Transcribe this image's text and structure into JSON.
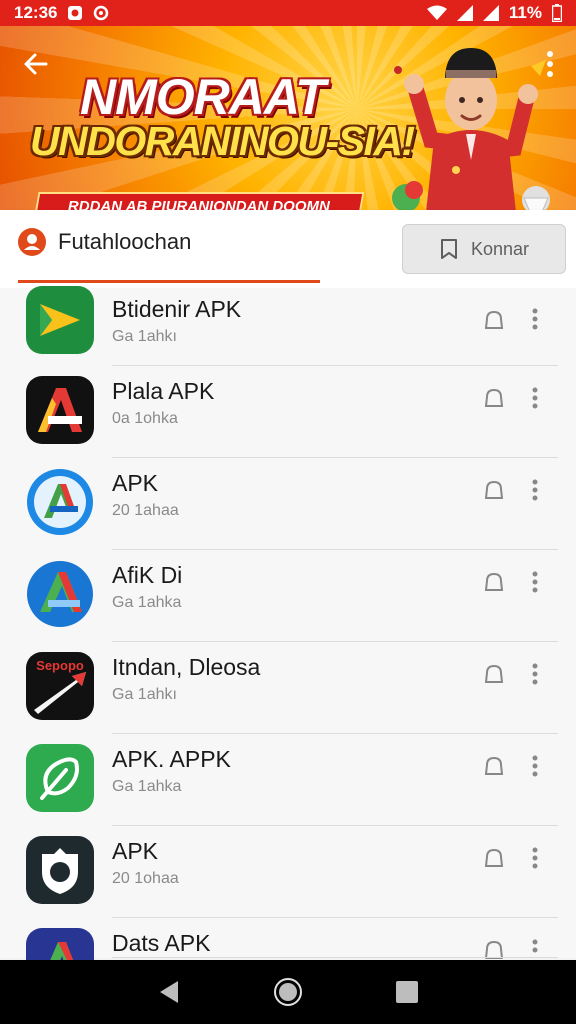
{
  "status_bar": {
    "time": "12:36",
    "battery": "11%",
    "icons": [
      "notification-icon",
      "sync-icon",
      "wifi-icon",
      "signal-icon",
      "signal-icon",
      "battery-icon"
    ]
  },
  "banner": {
    "title": "NMORAAT",
    "subtitle": "UNDORANINOU-SIA!",
    "ribbon": "RDDAN AB PIURANIONDAN DOOMN",
    "back_icon": "arrow-left-icon",
    "more_icon": "more-vertical-icon"
  },
  "tabs": {
    "active_label": "Futahloochan",
    "action_button": "Konnar",
    "user_icon": "user-icon",
    "action_icon": "bookmark-icon"
  },
  "apps": [
    {
      "name": "Btidenir APK",
      "sub": "Ga 1ahkı"
    },
    {
      "name": "Plala APK",
      "sub": "0a 1ohka"
    },
    {
      "name": "APK",
      "sub": "20 1ahaa"
    },
    {
      "name": "AfiK Di",
      "sub": "Ga 1ahka"
    },
    {
      "name": "Itndan, Dleosa",
      "sub": "Ga 1ahkı"
    },
    {
      "name": "APK. APPK",
      "sub": "Ga 1ahka"
    },
    {
      "name": "APK",
      "sub": "20 1ohaa"
    },
    {
      "name": "Dats APK",
      "sub": ""
    }
  ],
  "app_icon_badge_text": "Sepopo",
  "colors": {
    "accent": "#e04a1a",
    "status_bar": "#e0221b",
    "banner_gold": "#ffb300"
  },
  "nav_bar": {
    "icons": [
      "back-triangle-icon",
      "home-circle-icon",
      "recents-square-icon"
    ]
  }
}
